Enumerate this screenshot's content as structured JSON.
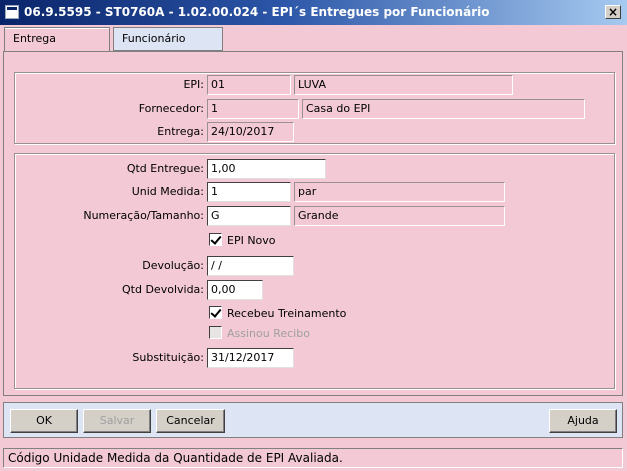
{
  "window": {
    "title": "06.9.5595 - ST0760A - 1.02.00.024 - EPI´s Entregues por Funcionário",
    "close_glyph": "×"
  },
  "tabs": [
    {
      "label": "Entrega",
      "active": true
    },
    {
      "label": "Funcionário",
      "active": false
    }
  ],
  "group1": {
    "epi_label": "EPI:",
    "epi_code": "01",
    "epi_desc": "LUVA",
    "fornecedor_label": "Fornecedor:",
    "fornecedor_code": "1",
    "fornecedor_desc": "Casa do EPI",
    "entrega_label": "Entrega:",
    "entrega_value": "24/10/2017"
  },
  "group2": {
    "qtd_entregue_label": "Qtd Entregue:",
    "qtd_entregue_value": "1,00",
    "unid_medida_label": "Unid Medida:",
    "unid_medida_code": "1",
    "unid_medida_desc": "par",
    "numeracao_label": "Numeração/Tamanho:",
    "numeracao_code": "G",
    "numeracao_desc": "Grande",
    "epi_novo_label": "EPI Novo",
    "epi_novo_checked": true,
    "devolucao_label": "Devolução:",
    "devolucao_value": " /  /",
    "qtd_devolvida_label": "Qtd Devolvida:",
    "qtd_devolvida_value": "0,00",
    "recebeu_treinamento_label": "Recebeu Treinamento",
    "recebeu_treinamento_checked": true,
    "assinou_recibo_label": "Assinou Recibo",
    "assinou_recibo_checked": false,
    "substituicao_label": "Substituição:",
    "substituicao_value": "31/12/2017"
  },
  "buttons": {
    "ok": "OK",
    "salvar": "Salvar",
    "cancelar": "Cancelar",
    "ajuda": "Ajuda"
  },
  "status": {
    "text": "Código Unidade Medida da Quantidade de EPI Avaliada."
  },
  "colors": {
    "background": "#f2c9d4",
    "title_bar": "#0a246a",
    "button_bar": "#dde4f4"
  }
}
